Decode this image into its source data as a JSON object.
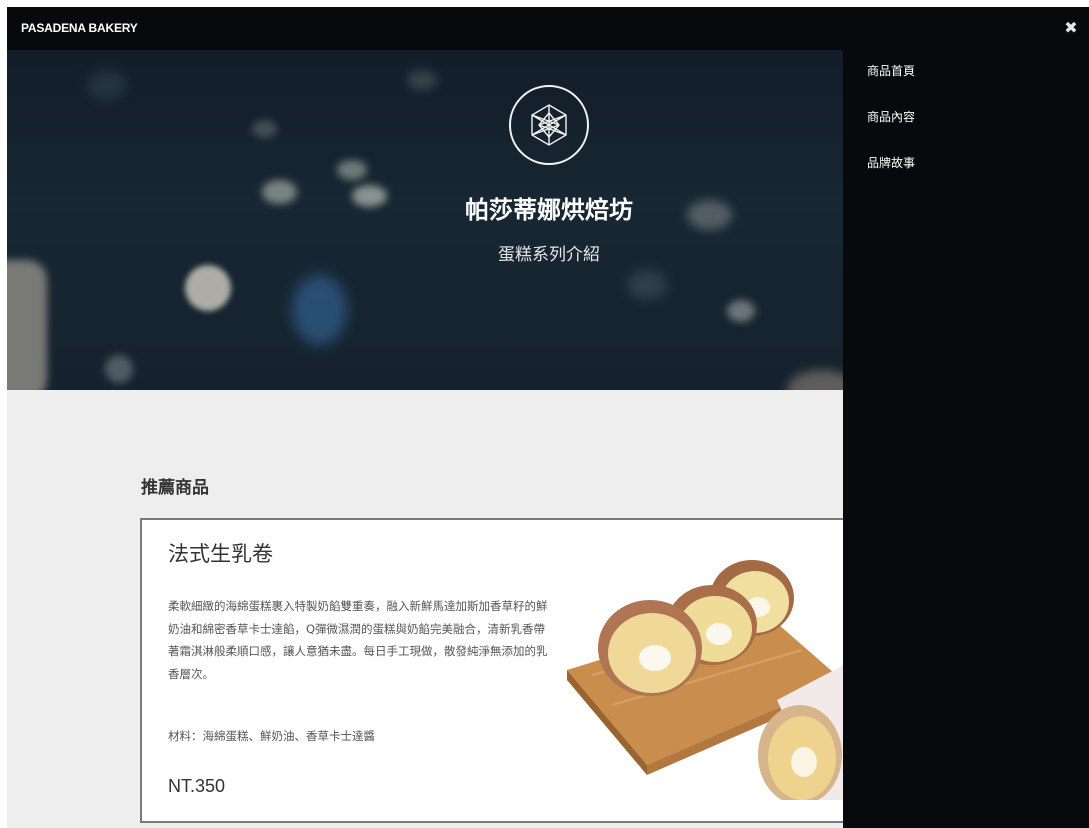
{
  "header": {
    "brand": "PASADENA BAKERY",
    "close_icon": "close-icon",
    "close_glyph": "✖"
  },
  "hero": {
    "title": "帕莎蒂娜烘焙坊",
    "subtitle": "蛋糕系列介紹",
    "logo_icon": "geometric-hexagon-logo"
  },
  "main": {
    "section_title": "推薦商品",
    "product": {
      "name": "法式生乳卷",
      "description": "柔軟細緻的海綿蛋糕裹入特製奶餡雙重奏，融入新鮮馬達加斯加香草籽的鮮奶油和綿密香草卡士達餡，Q彈微濕潤的蛋糕與奶餡完美融合，清新乳香帶著霜淇淋般柔順口感，讓人意猶未盡。每日手工現做，散發純淨無添加的乳香層次。",
      "materials": "材料：海綿蛋糕、鮮奶油、香草卡士達醬",
      "price": "NT.350",
      "image": "swiss-roll-cake-photo"
    }
  },
  "side_menu": {
    "items": [
      {
        "label": "商品首頁"
      },
      {
        "label": "商品內容"
      },
      {
        "label": "品牌故事"
      }
    ]
  },
  "colors": {
    "topbar_bg": "#07090c",
    "page_bg": "#eeeeee",
    "card_border": "#7a7a7a"
  }
}
